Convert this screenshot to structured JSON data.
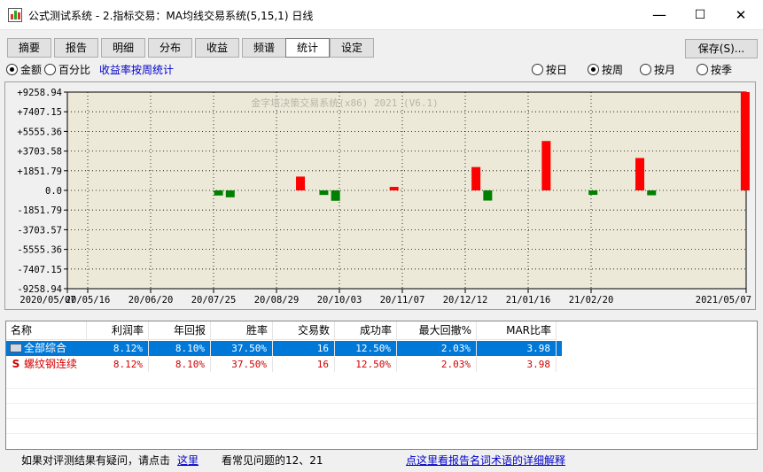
{
  "window": {
    "title": "公式测试系统 - 2.指标交易：MA均线交易系统(5,15,1) 日线",
    "minimize": "—",
    "maximize": "☐",
    "close": "✕"
  },
  "tabs": [
    "摘要",
    "报告",
    "明细",
    "分布",
    "收益",
    "频谱",
    "统计",
    "设定"
  ],
  "active_tab": "统计",
  "save_label": "保存(S)...",
  "mode": {
    "amount_label": "金额",
    "percent_label": "百分比",
    "selected": "金额",
    "period_link": "收益率按周统计"
  },
  "period": {
    "options": [
      "按日",
      "按周",
      "按月",
      "按季"
    ],
    "selected": "按周"
  },
  "chart_data": {
    "type": "bar",
    "watermark": "金字塔决策交易系统(x86) 2021 (V6.1)",
    "y_ticks": [
      "+9258.94",
      "+7407.15",
      "+5555.36",
      "+3703.58",
      "+1851.79",
      "0.0",
      "-1851.79",
      "-3703.57",
      "-5555.36",
      "-7407.15",
      "-9258.94"
    ],
    "ylim": [
      -9258.94,
      9258.94
    ],
    "x_ticks": [
      "2020/05/07",
      "20/05/16",
      "20/06/20",
      "20/07/25",
      "20/08/29",
      "20/10/03",
      "20/11/07",
      "20/12/12",
      "21/01/16",
      "21/02/20",
      "2021/05/07"
    ],
    "positive_color": "#ff0000",
    "negative_color": "#008000",
    "bars": [
      {
        "slot": 25,
        "value": -480
      },
      {
        "slot": 27,
        "value": -650
      },
      {
        "slot": 39,
        "value": 1300
      },
      {
        "slot": 43,
        "value": -430
      },
      {
        "slot": 45,
        "value": -980
      },
      {
        "slot": 55,
        "value": 330
      },
      {
        "slot": 69,
        "value": 2200
      },
      {
        "slot": 71,
        "value": -960
      },
      {
        "slot": 81,
        "value": 4650
      },
      {
        "slot": 89,
        "value": -420
      },
      {
        "slot": 97,
        "value": 3050
      },
      {
        "slot": 99,
        "value": -460
      },
      {
        "slot": 115,
        "value": 9258.94
      }
    ],
    "slots": 116
  },
  "table": {
    "headers": [
      "名称",
      "利润率",
      "年回报",
      "胜率",
      "交易数",
      "成功率",
      "最大回撤%",
      "MAR比率"
    ],
    "rows": [
      {
        "icon": "folder-icon",
        "cells": [
          "全部综合",
          "8.12%",
          "8.10%",
          "37.50%",
          "16",
          "12.50%",
          "2.03%",
          "3.98"
        ],
        "selected": true
      },
      {
        "icon": "S",
        "cells": [
          "螺纹钢连续",
          "8.12%",
          "8.10%",
          "37.50%",
          "16",
          "12.50%",
          "2.03%",
          "3.98"
        ],
        "selected": false
      }
    ]
  },
  "status": {
    "question_text": "如果对评测结果有疑问，请点击",
    "here_link": "这里",
    "faq_text": "看常见问题的12、21",
    "glossary_link": "点这里看报告名词术语的详细解释"
  }
}
